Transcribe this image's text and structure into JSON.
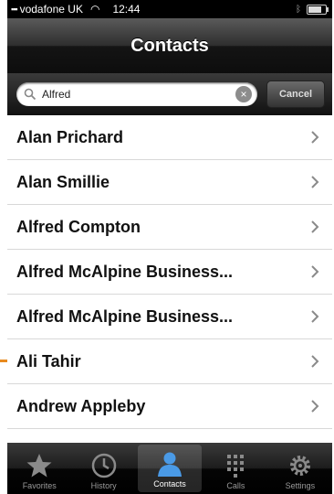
{
  "status_bar": {
    "carrier": "vodafone UK",
    "time": "12:44"
  },
  "nav": {
    "title": "Contacts"
  },
  "search": {
    "value": "Alfred",
    "clear_glyph": "×",
    "cancel_label": "Cancel"
  },
  "contacts": [
    {
      "name": "Alan Prichard"
    },
    {
      "name": "Alan Smillie"
    },
    {
      "name": "Alfred Compton"
    },
    {
      "name": "Alfred McAlpine Business..."
    },
    {
      "name": "Alfred McAlpine Business..."
    },
    {
      "name": "Ali Tahir"
    },
    {
      "name": "Andrew Appleby"
    }
  ],
  "tabs": [
    {
      "label": "Favorites",
      "icon": "star-icon"
    },
    {
      "label": "History",
      "icon": "clock-icon"
    },
    {
      "label": "Contacts",
      "icon": "person-icon",
      "active": true
    },
    {
      "label": "Calls",
      "icon": "keypad-icon"
    },
    {
      "label": "Settings",
      "icon": "gear-icon"
    }
  ],
  "colors": {
    "accent": "#3a8ad8",
    "orange_marker": "#e88a1f"
  }
}
